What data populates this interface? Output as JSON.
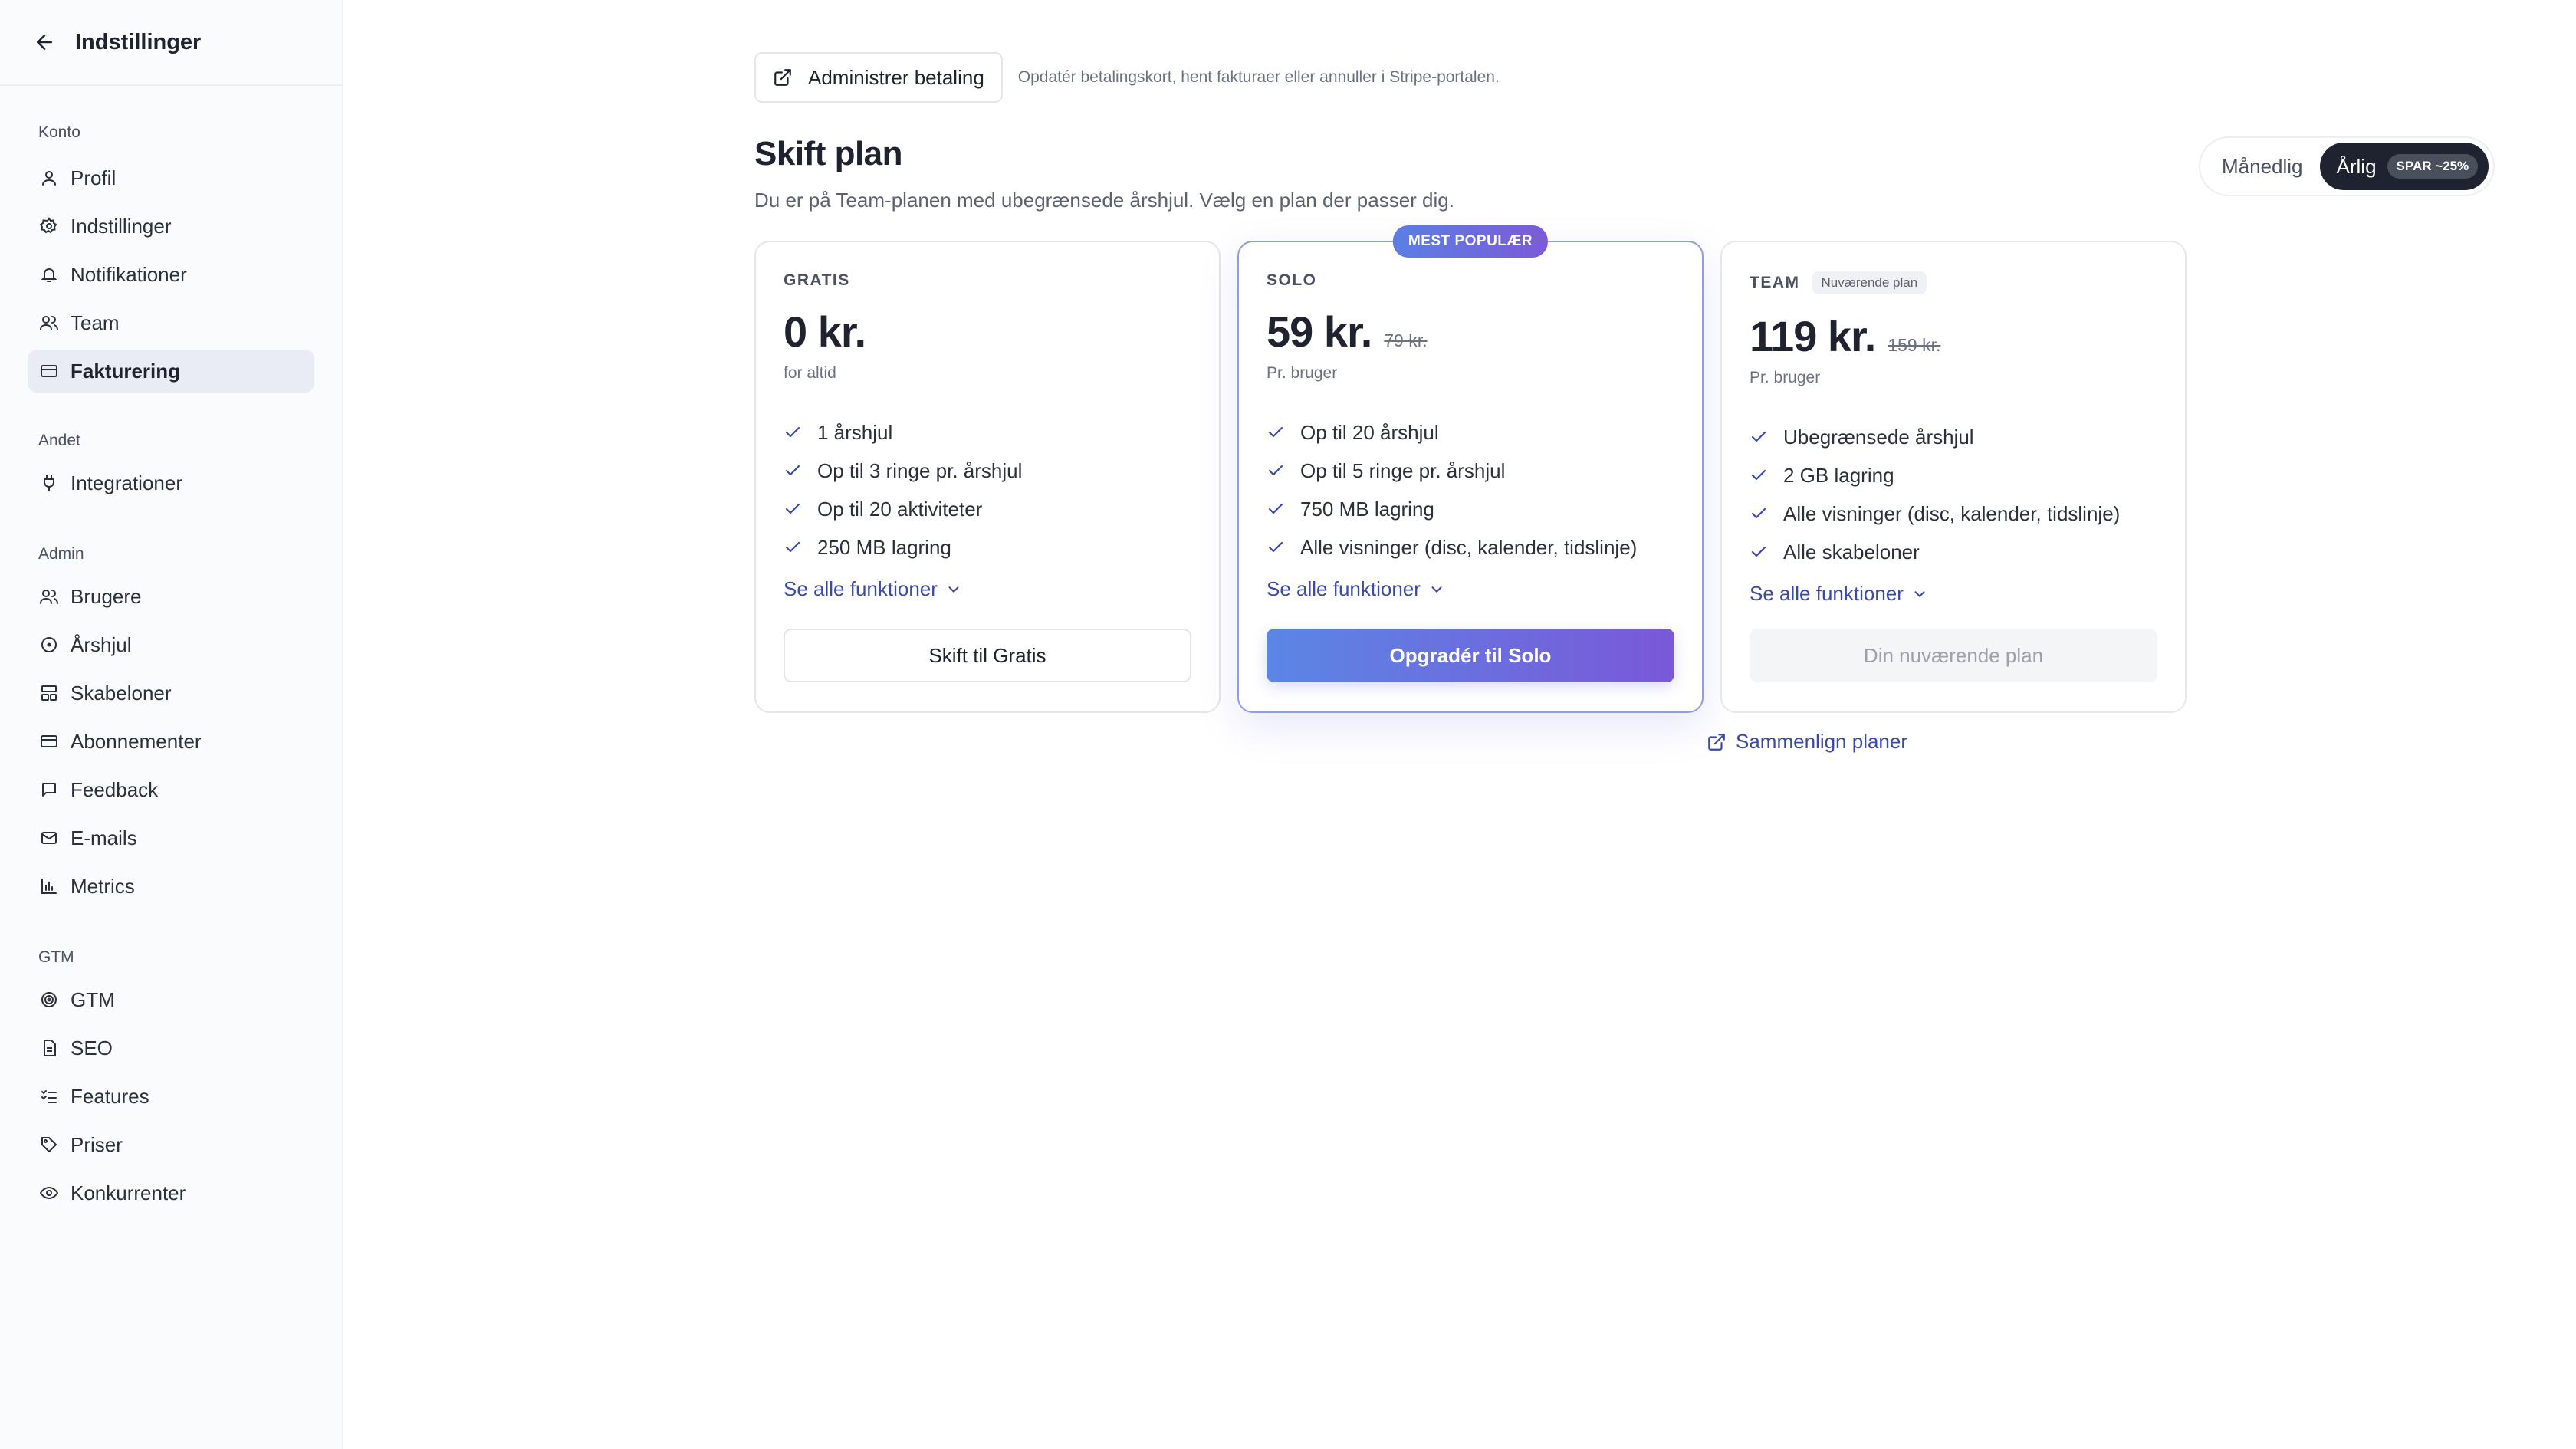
{
  "sidebar": {
    "title": "Indstillinger",
    "sections": [
      {
        "label": "Konto",
        "items": [
          {
            "label": "Profil",
            "icon": "user-icon"
          },
          {
            "label": "Indstillinger",
            "icon": "gear-icon"
          },
          {
            "label": "Notifikationer",
            "icon": "bell-icon"
          },
          {
            "label": "Team",
            "icon": "users-icon"
          },
          {
            "label": "Fakturering",
            "icon": "credit-card-icon",
            "active": true
          }
        ]
      },
      {
        "label": "Andet",
        "items": [
          {
            "label": "Integrationer",
            "icon": "plug-icon"
          }
        ]
      },
      {
        "label": "Admin",
        "items": [
          {
            "label": "Brugere",
            "icon": "users-icon"
          },
          {
            "label": "Årshjul",
            "icon": "circle-icon"
          },
          {
            "label": "Skabeloner",
            "icon": "layout-icon"
          },
          {
            "label": "Abonnementer",
            "icon": "credit-card-icon"
          },
          {
            "label": "Feedback",
            "icon": "message-icon"
          },
          {
            "label": "E-mails",
            "icon": "mail-icon"
          },
          {
            "label": "Metrics",
            "icon": "bar-chart-icon"
          }
        ]
      },
      {
        "label": "GTM",
        "items": [
          {
            "label": "GTM",
            "icon": "target-icon"
          },
          {
            "label": "SEO",
            "icon": "file-icon"
          },
          {
            "label": "Features",
            "icon": "checklist-icon"
          },
          {
            "label": "Priser",
            "icon": "tag-icon"
          },
          {
            "label": "Konkurrenter",
            "icon": "eye-icon"
          }
        ]
      }
    ]
  },
  "billing": {
    "manage_label": "Administrer betaling",
    "manage_help": "Opdatér betalingskort, hent fakturaer eller annuller i Stripe-portalen."
  },
  "plans_header": {
    "title": "Skift plan",
    "subtitle": "Du er på Team-planen med ubegrænsede årshjul. Vælg en plan der passer dig."
  },
  "billing_toggle": {
    "monthly": "Månedlig",
    "yearly": "Årlig",
    "yearly_badge": "SPAR ~25%",
    "selected": "yearly"
  },
  "plans": [
    {
      "name": "GRATIS",
      "price": "0 kr.",
      "old_price": "",
      "unit": "for altid",
      "features": [
        "1 årshjul",
        "Op til 3 ringe pr. årshjul",
        "Op til 20 aktiviteter",
        "250 MB lagring"
      ],
      "see_all": "Se alle funktioner",
      "cta": "Skift til Gratis"
    },
    {
      "name": "SOLO",
      "badge": "MEST POPULÆR",
      "price": "59 kr.",
      "old_price": "79 kr.",
      "unit": "Pr. bruger",
      "features": [
        "Op til 20 årshjul",
        "Op til 5 ringe pr. årshjul",
        "750 MB lagring",
        "Alle visninger (disc, kalender, tidslinje)"
      ],
      "see_all": "Se alle funktioner",
      "cta": "Opgradér til Solo"
    },
    {
      "name": "TEAM",
      "current_tag": "Nuværende plan",
      "price": "119 kr.",
      "old_price": "159 kr.",
      "unit": "Pr. bruger",
      "features": [
        "Ubegrænsede årshjul",
        "2 GB lagring",
        "Alle visninger (disc, kalender, tidslinje)",
        "Alle skabeloner"
      ],
      "see_all": "Se alle funktioner",
      "cta": "Din nuværende plan"
    }
  ],
  "compare_label": "Sammenlign planer",
  "colors": {
    "accent_link": "#3a4aa8",
    "gradient_start": "#5b86e5",
    "gradient_end": "#7a58d8",
    "active_nav_bg": "#e9ecf5"
  }
}
